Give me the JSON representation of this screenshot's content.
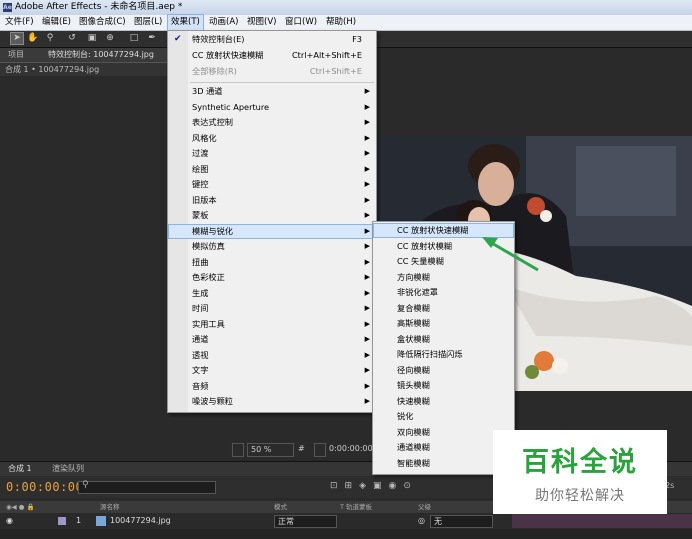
{
  "app": {
    "title": "Adobe After Effects - 未命名项目.aep *",
    "logo": "Ae"
  },
  "menubar": {
    "items": [
      {
        "label": "文件(F)"
      },
      {
        "label": "编辑(E)"
      },
      {
        "label": "图像合成(C)"
      },
      {
        "label": "图层(L)"
      },
      {
        "label": "效果(T)"
      },
      {
        "label": "动画(A)"
      },
      {
        "label": "视图(V)"
      },
      {
        "label": "窗口(W)"
      },
      {
        "label": "帮助(H)"
      }
    ]
  },
  "panels": {
    "project_tab": "项目",
    "effects_tab": "特效控制台: 100477294.jpg",
    "comp_header": "合成 1 • 100477294.jpg"
  },
  "effect_menu": {
    "top_items": [
      {
        "label": "特效控制台(E)",
        "shortcut": "F3",
        "checked": true
      },
      {
        "label": "CC 放射状快速模糊",
        "shortcut": "Ctrl+Alt+Shift+E"
      },
      {
        "label": "全部移除(R)",
        "shortcut": "Ctrl+Shift+E",
        "disabled": true
      }
    ],
    "categories": [
      "3D 通道",
      "Synthetic Aperture",
      "表达式控制",
      "风格化",
      "过渡",
      "绘图",
      "键控",
      "旧版本",
      "蒙板",
      "模糊与锐化",
      "模拟仿真",
      "扭曲",
      "色彩校正",
      "生成",
      "时间",
      "实用工具",
      "通道",
      "透视",
      "文字",
      "音频",
      "噪波与颗粒"
    ],
    "highlighted": "模糊与锐化"
  },
  "blur_submenu": {
    "items": [
      "CC 放射状快速模糊",
      "CC 放射状模糊",
      "CC 矢量模糊",
      "方向模糊",
      "非锐化遮罩",
      "复合模糊",
      "高斯模糊",
      "盒状模糊",
      "降低隔行扫描闪烁",
      "径向模糊",
      "镜头模糊",
      "快速模糊",
      "锐化",
      "双向模糊",
      "通道模糊",
      "智能模糊"
    ],
    "highlighted": "CC 放射状快速模糊"
  },
  "viewer": {
    "zoom": "50 %",
    "timecode": "0:00:00:00"
  },
  "timeline": {
    "tab_comp": "合成 1",
    "tab_render": "渲染队列",
    "timecode": "0:00:00:00",
    "col_source": "源名称",
    "col_mode": "模式",
    "col_trkmat": "T  轨道蒙板",
    "col_parent": "父级",
    "ruler_end": "02s",
    "layer_index": "1",
    "layer_name": "100477294.jpg",
    "layer_mode": "正常",
    "layer_parent": "无"
  },
  "watermark": {
    "title": "百科全说",
    "subtitle": "助你轻松解决"
  },
  "colors": {
    "timecode": "#e6a23c",
    "menu_highlight": "#d6e7fb",
    "watermark_green": "#29a33b",
    "arrow_green": "#2da44e"
  }
}
